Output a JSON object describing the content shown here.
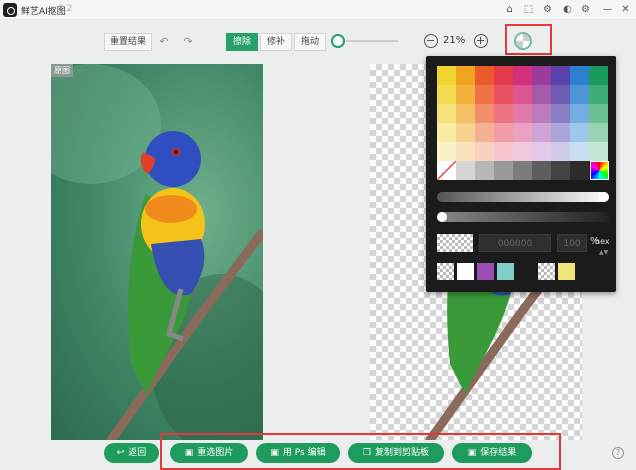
{
  "app": {
    "title": "鲜艺AI抠图",
    "version": "2.2"
  },
  "toolbar": {
    "reset_label": "重置结果",
    "undo_icon": "undo-icon",
    "redo_icon": "redo-icon",
    "modes": [
      "擦除",
      "修补",
      "拖动"
    ],
    "active_mode": "擦除",
    "zoom": "21%",
    "slider_level": 0
  },
  "original": {
    "tag": "原图"
  },
  "picker": {
    "hex_placeholder": "000000",
    "opacity": "100",
    "percent": "%",
    "hex_label": "hex",
    "palette": [
      [
        "#f2d430",
        "#f1a41f",
        "#ea5a2c",
        "#e23a4a",
        "#d52f7c",
        "#9b3b9c",
        "#5b42a9",
        "#2f7fd0",
        "#1a9a5c"
      ],
      [
        "#f3dc52",
        "#f3b13e",
        "#ee7246",
        "#e85364",
        "#dc5590",
        "#a759aa",
        "#6e5cb6",
        "#4e95d8",
        "#3fad78"
      ],
      [
        "#f5e37a",
        "#f5c064",
        "#f28e69",
        "#ed7485",
        "#e279a7",
        "#ba7cbd",
        "#8a7ec6",
        "#74ade0",
        "#6ac095"
      ],
      [
        "#f8eba3",
        "#f8d290",
        "#f6b094",
        "#f39dab",
        "#eaa1c2",
        "#cfa3d3",
        "#aba6d9",
        "#9fc7ea",
        "#98d4b4"
      ],
      [
        "#faf2c8",
        "#fae3bc",
        "#fad0c0",
        "#f8c5cf",
        "#f2c8dc",
        "#e2c9e7",
        "#cfcdea",
        "#c8def3",
        "#c4e7d3"
      ]
    ],
    "grays": [
      "#ffffff",
      "#d6d6d6",
      "#b8b8b8",
      "#9a9a9a",
      "#7c7c7c",
      "#5e5e5e",
      "#434343",
      "#2c2c2c"
    ],
    "recent": [
      "#ffffff",
      "#9b4fb5",
      "#7ecdc6",
      "#f0e47a"
    ]
  },
  "actions": {
    "back": "返回",
    "reselect": "重选图片",
    "ps": "用 Ps 编辑",
    "copy": "复制到剪贴板",
    "save": "保存结果"
  },
  "help": "?"
}
